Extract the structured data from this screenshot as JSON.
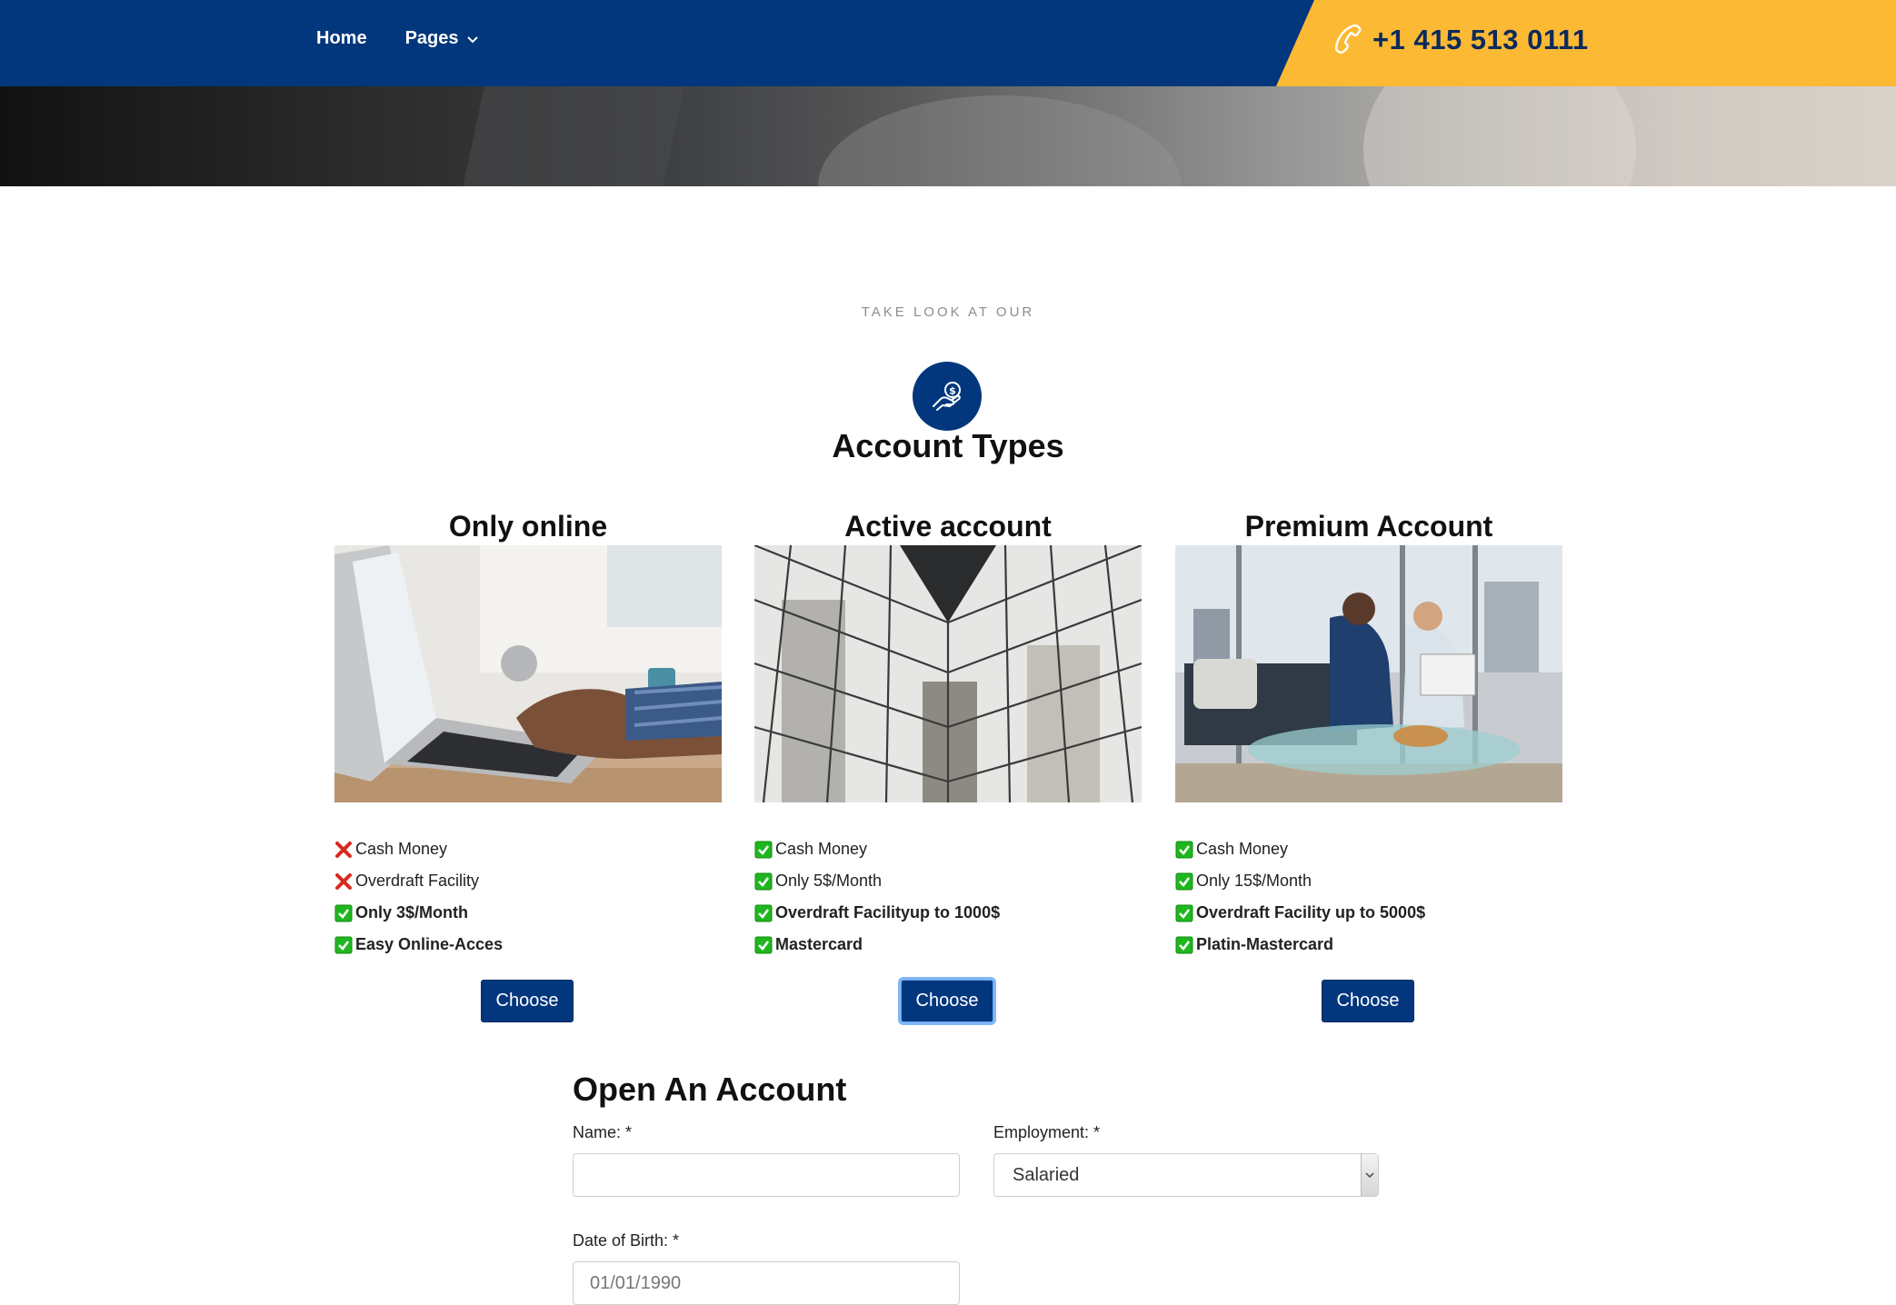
{
  "nav": {
    "items": [
      {
        "label": "Home"
      },
      {
        "label": "Pages"
      }
    ],
    "phone": "+1 415 513 0111"
  },
  "section": {
    "eyebrow": "TAKE LOOK AT OUR",
    "title": "Account Types",
    "icon": "money-hand-icon"
  },
  "cards": [
    {
      "title": "Only online",
      "image": "laptop-typing-photo",
      "features": [
        {
          "label": "Cash Money",
          "included": false,
          "bold": false
        },
        {
          "label": "Overdraft Facility",
          "included": false,
          "bold": false
        },
        {
          "label": "Only 3$/Month",
          "included": true,
          "bold": true
        },
        {
          "label": "Easy Online-Acces",
          "included": true,
          "bold": true
        }
      ],
      "button": "Choose"
    },
    {
      "title": "Active account",
      "image": "glass-building-photo",
      "features": [
        {
          "label": "Cash Money",
          "included": true,
          "bold": false
        },
        {
          "label": "Only 5$/Month",
          "included": true,
          "bold": false
        },
        {
          "label": "Overdraft Facilityup to 1000$",
          "included": true,
          "bold": true
        },
        {
          "label": "Mastercard",
          "included": true,
          "bold": true
        }
      ],
      "button": "Choose"
    },
    {
      "title": "Premium Account",
      "image": "business-meeting-photo",
      "features": [
        {
          "label": "Cash Money",
          "included": true,
          "bold": false
        },
        {
          "label": "Only 15$/Month",
          "included": true,
          "bold": false
        },
        {
          "label": "Overdraft Facility up to 5000$",
          "included": true,
          "bold": true
        },
        {
          "label": "Platin-Mastercard",
          "included": true,
          "bold": true
        }
      ],
      "button": "Choose"
    }
  ],
  "form": {
    "title": "Open An Account",
    "name_label": "Name: *",
    "name_value": "",
    "employment_label": "Employment: *",
    "employment_value": "Salaried",
    "dob_label": "Date of Birth: *",
    "dob_value": "01/01/1990"
  },
  "colors": {
    "primary": "#03377d",
    "accent": "#fcb934",
    "check": "#1fb61f",
    "cross": "#d62a1e"
  }
}
